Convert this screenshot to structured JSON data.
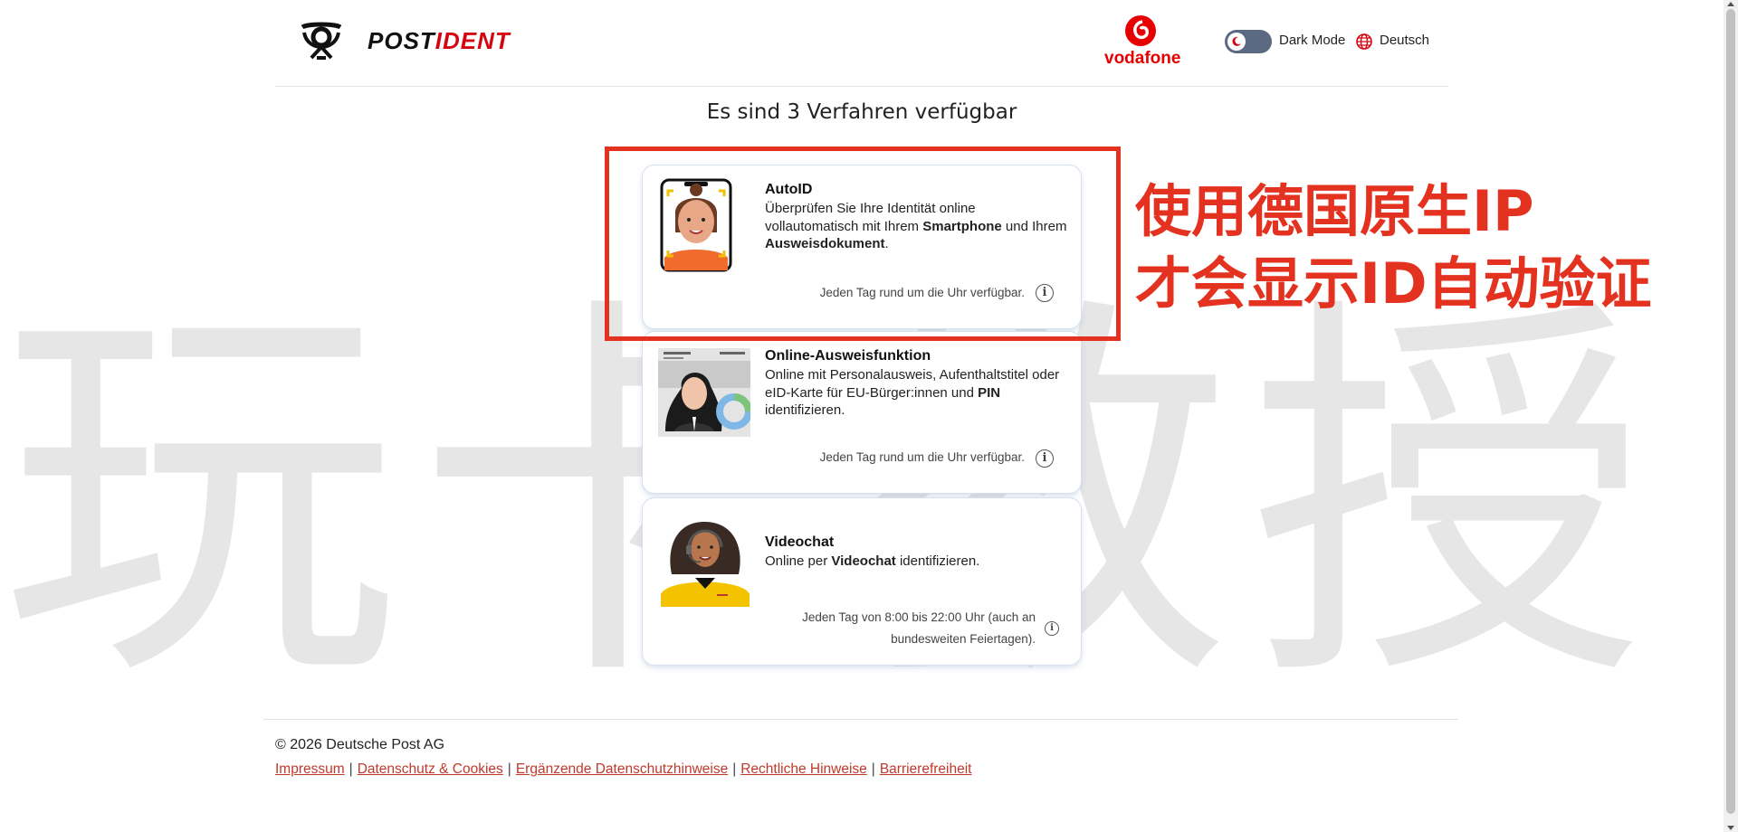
{
  "watermark": "玩卡教授",
  "header": {
    "brand_part1": "POST",
    "brand_part2": "IDENT",
    "partner_name": "vodafone",
    "dark_mode_label": "Dark Mode",
    "language_label": "Deutsch"
  },
  "main": {
    "title": "Es sind 3 Verfahren verfügbar",
    "methods": [
      {
        "title": "AutoID",
        "desc_parts": [
          "Überprüfen Sie Ihre Identität online vollautomatisch mit Ihrem ",
          "Smartphone",
          " und Ihrem ",
          "Ausweisdokument",
          "."
        ],
        "availability": "Jeden Tag rund um die Uhr verfügbar.",
        "info": "i"
      },
      {
        "title": "Online-Ausweisfunktion",
        "desc_parts": [
          "Online mit Personalausweis, Aufenthaltstitel oder eID-Karte für EU-Bürger:innen und ",
          "PIN",
          " identifizieren."
        ],
        "availability": "Jeden Tag rund um die Uhr verfügbar.",
        "info": "i"
      },
      {
        "title": "Videochat",
        "desc_parts": [
          "Online per ",
          "Videochat",
          " identifizieren."
        ],
        "availability_line1": "Jeden Tag von 8:00 bis 22:00 Uhr (auch an",
        "availability_line2": "bundesweiten Feiertagen).",
        "info": "i"
      }
    ]
  },
  "annotation": {
    "line1": "使用德国原生IP",
    "line2": "才会显示ID自动验证"
  },
  "footer": {
    "copyright": "© 2026 Deutsche Post AG",
    "links": [
      "Impressum",
      "Datenschutz & Cookies",
      "Ergänzende Datenschutzhinweise",
      "Rechtliche Hinweise",
      "Barrierefreiheit"
    ],
    "separator": "|"
  },
  "colors": {
    "brand_red": "#d40511",
    "annotation_red": "#e3321f",
    "vodafone_red": "#e60000",
    "link_red": "#c0392b"
  }
}
